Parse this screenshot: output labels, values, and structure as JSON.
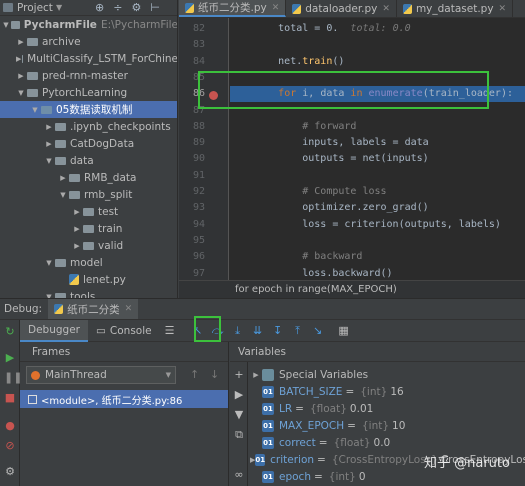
{
  "project": {
    "header": "Project",
    "tree": [
      {
        "label": "PycharmFile",
        "hint": "E:\\PycharmFile",
        "depth": 0,
        "arrow": "▼",
        "icon": "folder",
        "bold": true
      },
      {
        "label": "archive",
        "depth": 1,
        "arrow": "▶",
        "icon": "folder"
      },
      {
        "label": "MultiClassify_LSTM_ForChine",
        "depth": 1,
        "arrow": "▶",
        "icon": "folder"
      },
      {
        "label": "pred-rnn-master",
        "depth": 1,
        "arrow": "▶",
        "icon": "folder"
      },
      {
        "label": "PytorchLearning",
        "depth": 1,
        "arrow": "▼",
        "icon": "folder"
      },
      {
        "label": "05数据读取机制",
        "depth": 2,
        "arrow": "▼",
        "icon": "folder",
        "selected": true
      },
      {
        "label": ".ipynb_checkpoints",
        "depth": 3,
        "arrow": "▶",
        "icon": "folder"
      },
      {
        "label": "CatDogData",
        "depth": 3,
        "arrow": "▶",
        "icon": "folder"
      },
      {
        "label": "data",
        "depth": 3,
        "arrow": "▼",
        "icon": "folder"
      },
      {
        "label": "RMB_data",
        "depth": 4,
        "arrow": "▶",
        "icon": "folder"
      },
      {
        "label": "rmb_split",
        "depth": 4,
        "arrow": "▼",
        "icon": "folder"
      },
      {
        "label": "test",
        "depth": 5,
        "arrow": "▶",
        "icon": "folder"
      },
      {
        "label": "train",
        "depth": 5,
        "arrow": "▶",
        "icon": "folder"
      },
      {
        "label": "valid",
        "depth": 5,
        "arrow": "▶",
        "icon": "folder"
      },
      {
        "label": "model",
        "depth": 3,
        "arrow": "▼",
        "icon": "folder"
      },
      {
        "label": "lenet.py",
        "depth": 4,
        "arrow": "",
        "icon": "py"
      },
      {
        "label": "tools",
        "depth": 3,
        "arrow": "▼",
        "icon": "folder"
      }
    ]
  },
  "editor": {
    "tabs": [
      {
        "label": "纸币二分类.py",
        "active": true
      },
      {
        "label": "dataloader.py",
        "active": false
      },
      {
        "label": "my_dataset.py",
        "active": false
      }
    ],
    "lines": [
      {
        "num": "82",
        "html": "        total = 0.  <span class='hintc'>total: 0.0</span>"
      },
      {
        "num": "83",
        "html": ""
      },
      {
        "num": "84",
        "html": "        net.<span class='fn'>train</span>()"
      },
      {
        "num": "85",
        "html": ""
      },
      {
        "num": "86",
        "html": "        <span class='kw'>for</span> i, data <span class='kw'>in</span> <span class='bi'>enumerate</span>(train_loader):",
        "highlight": true,
        "breakpoint": true
      },
      {
        "num": "87",
        "html": ""
      },
      {
        "num": "88",
        "html": "            <span class='cm'># forward</span>"
      },
      {
        "num": "89",
        "html": "            inputs, labels = data"
      },
      {
        "num": "90",
        "html": "            outputs = net(inputs)"
      },
      {
        "num": "91",
        "html": ""
      },
      {
        "num": "92",
        "html": "            <span class='cm'># Compute loss</span>"
      },
      {
        "num": "93",
        "html": "            optimizer.zero_grad()"
      },
      {
        "num": "94",
        "html": "            loss = criterion(outputs, labels)"
      },
      {
        "num": "95",
        "html": ""
      },
      {
        "num": "96",
        "html": "            <span class='cm'># backward</span>"
      },
      {
        "num": "97",
        "html": "            loss.backward()"
      }
    ],
    "breadcrumb": "for epoch in range(MAX_EPOCH)"
  },
  "debug": {
    "label": "Debug:",
    "tab": "纸币二分类",
    "subtabs": [
      "Debugger",
      "Console"
    ],
    "frames_header": "Frames",
    "thread": "MainThread",
    "frame": "<module>, 纸币二分类.py:86",
    "variables_header": "Variables",
    "variables": [
      {
        "name": "Special Variables",
        "type": "",
        "value": "",
        "special": true,
        "expand": "▶"
      },
      {
        "name": "BATCH_SIZE",
        "type": "{int}",
        "value": "16"
      },
      {
        "name": "LR",
        "type": "{float}",
        "value": "0.01"
      },
      {
        "name": "MAX_EPOCH",
        "type": "{int}",
        "value": "10"
      },
      {
        "name": "correct",
        "type": "{float}",
        "value": "0.0"
      },
      {
        "name": "criterion",
        "type": "{CrossEntropyLoss}",
        "value": "CrossEntropyLoss()",
        "expand": "▶"
      },
      {
        "name": "epoch",
        "type": "{int}",
        "value": "0"
      }
    ]
  },
  "watermark": "知乎 @naruto",
  "colors": {
    "accent": "#4a88c7",
    "highlight_box": "#3cc13c",
    "current_line": "#2d6099"
  }
}
